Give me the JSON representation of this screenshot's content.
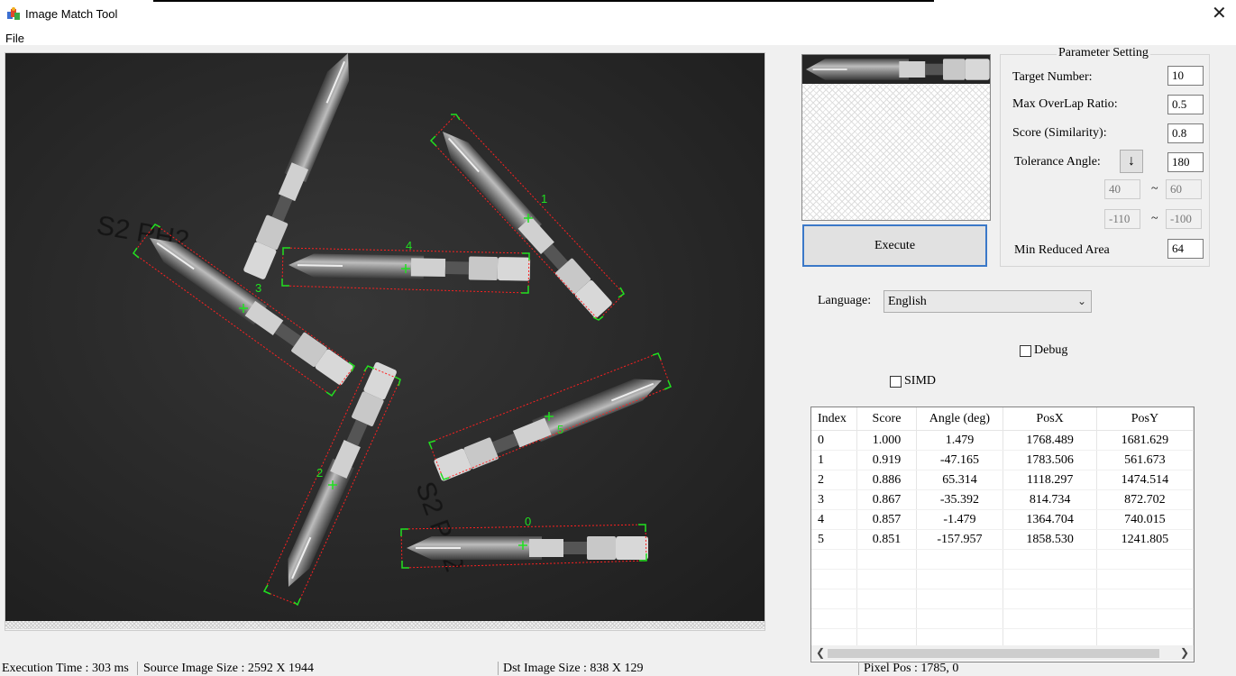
{
  "window": {
    "title": "Image Match Tool",
    "close_glyph": "✕"
  },
  "menu": {
    "file": "File"
  },
  "canvas": {
    "labels": [
      "0",
      "1",
      "2",
      "3",
      "4",
      "5"
    ]
  },
  "execute_label": "Execute",
  "params": {
    "legend": "Parameter Setting",
    "target_number_label": "Target Number:",
    "target_number": "10",
    "max_overlap_label": "Max OverLap Ratio:",
    "max_overlap": "0.5",
    "score_label": "Score (Similarity):",
    "score": "0.8",
    "tolerance_label": "Tolerance Angle:",
    "tolerance_arrow": "↓",
    "tolerance": "180",
    "range1_min": "40",
    "range1_max": "60",
    "range2_min": "-110",
    "range2_max": "-100",
    "tilde": "~",
    "min_reduced_label": "Min Reduced Area",
    "min_reduced": "64"
  },
  "language": {
    "label": "Language:",
    "value": "English"
  },
  "debug_label": "Debug",
  "simd_label": "SIMD",
  "results": {
    "headers": [
      "Index",
      "Score",
      "Angle (deg)",
      "PosX",
      "PosY"
    ],
    "rows": [
      [
        "0",
        "1.000",
        "1.479",
        "1768.489",
        "1681.629"
      ],
      [
        "1",
        "0.919",
        "-47.165",
        "1783.506",
        "561.673"
      ],
      [
        "2",
        "0.886",
        "65.314",
        "1118.297",
        "1474.514"
      ],
      [
        "3",
        "0.867",
        "-35.392",
        "814.734",
        "872.702"
      ],
      [
        "4",
        "0.857",
        "-1.479",
        "1364.704",
        "740.015"
      ],
      [
        "5",
        "0.851",
        "-157.957",
        "1858.530",
        "1241.805"
      ]
    ]
  },
  "status": {
    "exec_time": "Execution Time : 303 ms",
    "source_size": "Source Image Size : 2592 X 1944",
    "dst_size": "Dst Image Size : 838 X 129",
    "pixel_pos": "Pixel Pos : 1785, 0"
  },
  "colors": {
    "match_box": "#ff2020",
    "match_marker": "#20e020",
    "execute_border": "#3b78c8"
  }
}
